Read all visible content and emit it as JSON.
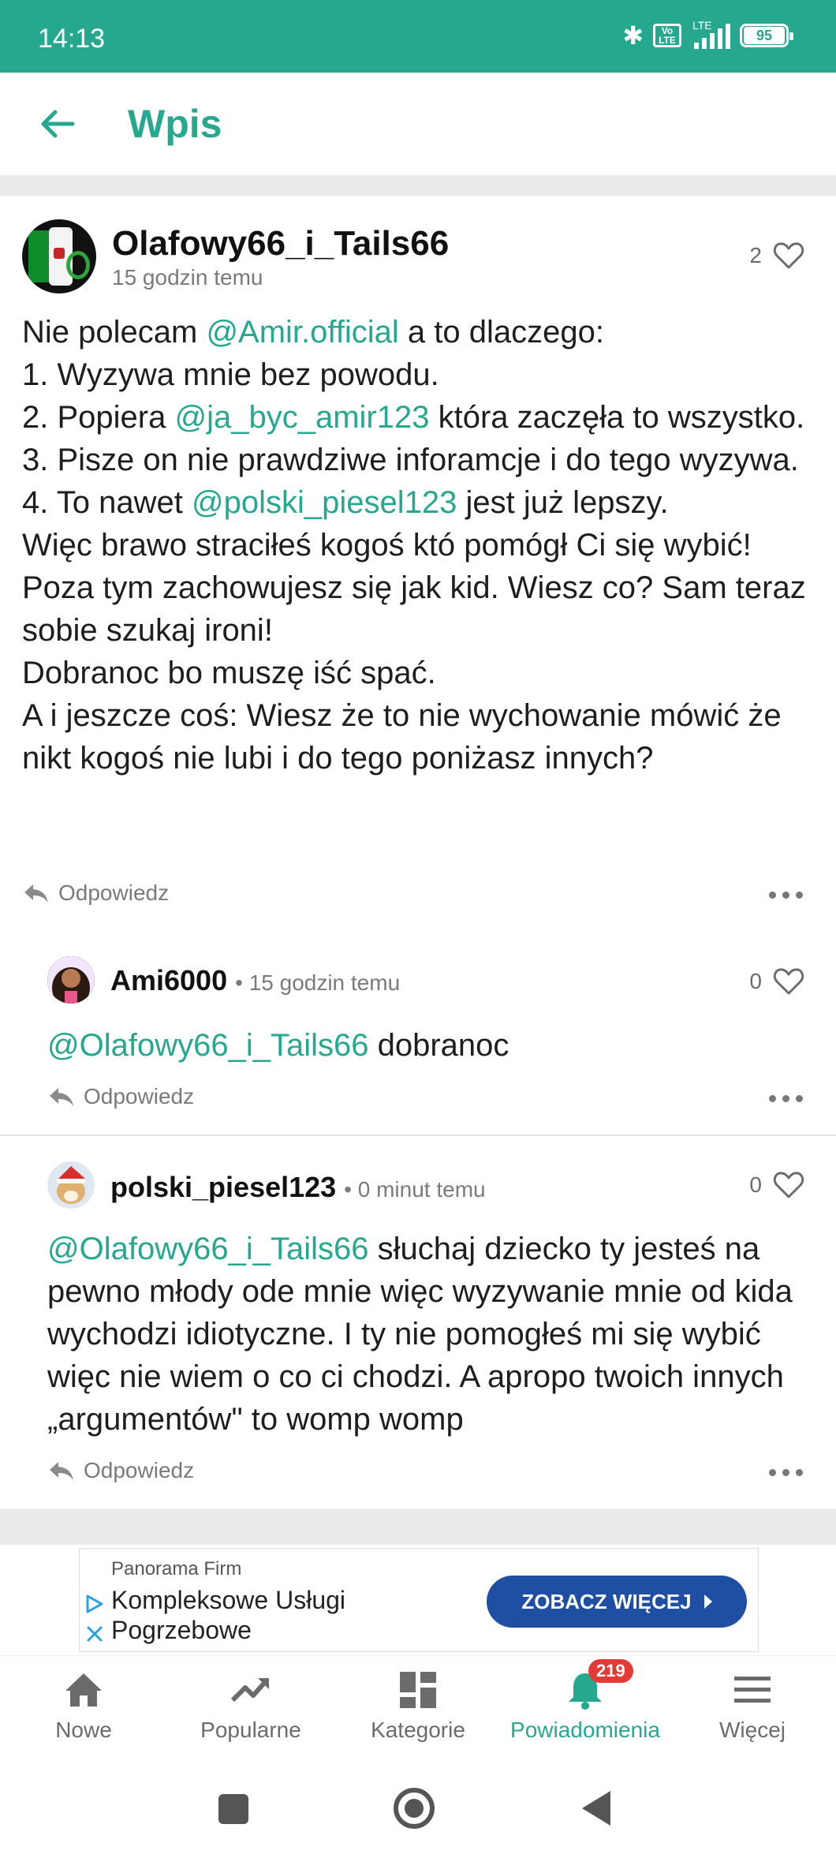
{
  "status_bar": {
    "time": "14:13",
    "network": "LTE",
    "volte": "Vo LTE",
    "battery": "95"
  },
  "header": {
    "title": "Wpis"
  },
  "post": {
    "author": "Olafowy66_i_Tails66",
    "time": "15 godzin temu",
    "likes": "2",
    "body": [
      [
        {
          "t": "Nie polecam "
        },
        {
          "t": "@Amir.official",
          "m": true
        },
        {
          "t": " a to dlaczego:"
        }
      ],
      [
        {
          "t": "1. Wyzywa mnie bez powodu."
        }
      ],
      [
        {
          "t": "2. Popiera "
        },
        {
          "t": "@ja_byc_amir123",
          "m": true
        },
        {
          "t": " która zaczęła to wszystko."
        }
      ],
      [
        {
          "t": "3. Pisze on nie prawdziwe inforamcje i do tego wyzywa."
        }
      ],
      [
        {
          "t": "4. To nawet "
        },
        {
          "t": "@polski_piesel123",
          "m": true
        },
        {
          "t": " jest już lepszy."
        }
      ],
      [
        {
          "t": "Więc brawo straciłeś kogoś któ pomógł Ci się wybić! Poza tym zachowujesz się jak kid. Wiesz co? Sam teraz sobie szukaj ironi!"
        }
      ],
      [
        {
          "t": "Dobranoc bo muszę iść spać."
        }
      ],
      [
        {
          "t": "A i jeszcze coś: Wiesz że to nie wychowanie mówić że nikt kogoś nie lubi i do tego poniżasz innych?"
        }
      ]
    ],
    "reply_label": "Odpowiedz"
  },
  "comments": [
    {
      "author": "Ami6000",
      "time": "• 15 godzin temu",
      "likes": "0",
      "body": [
        [
          {
            "t": "@Olafowy66_i_Tails66",
            "m": true
          },
          {
            "t": " dobranoc"
          }
        ]
      ],
      "reply_label": "Odpowiedz"
    },
    {
      "author": "polski_piesel123",
      "time": "• 0 minut temu",
      "likes": "0",
      "body": [
        [
          {
            "t": "@Olafowy66_i_Tails66",
            "m": true
          },
          {
            "t": " słuchaj dziecko ty jesteś na pewno młody ode mnie więc wyzywanie mnie od kida wychodzi idiotyczne. I ty nie pomogłeś mi się wybić więc nie wiem o co ci chodzi. A apropo twoich innych „argumentów\" to womp womp"
          }
        ]
      ],
      "reply_label": "Odpowiedz"
    }
  ],
  "ad": {
    "brand": "Panorama Firm",
    "headline": "Kompleksowe Usługi Pogrzebowe",
    "cta": "ZOBACZ WIĘCEJ"
  },
  "bottom_nav": {
    "items": [
      {
        "label": "Nowe",
        "icon": "home-icon"
      },
      {
        "label": "Popularne",
        "icon": "trending-icon"
      },
      {
        "label": "Kategorie",
        "icon": "grid-icon"
      },
      {
        "label": "Powiadomienia",
        "icon": "bell-icon",
        "badge": "219",
        "active": true
      },
      {
        "label": "Więcej",
        "icon": "menu-icon"
      }
    ]
  },
  "colors": {
    "accent": "#26a88f",
    "cta": "#1f4fa2",
    "badge": "#e53935"
  }
}
